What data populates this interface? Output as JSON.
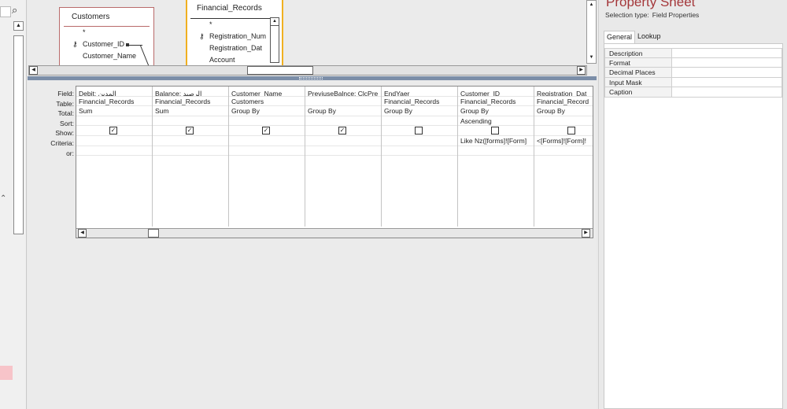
{
  "nav": {
    "search_icon": "search-icon"
  },
  "tables": {
    "customers": {
      "title": "Customers",
      "fields": [
        {
          "name": "*",
          "key": false
        },
        {
          "name": "Customer_ID",
          "key": true
        },
        {
          "name": "Customer_Name",
          "key": false
        }
      ]
    },
    "financial_records": {
      "title": "Financial_Records",
      "fields": [
        {
          "name": "*",
          "key": false
        },
        {
          "name": "Registration_Num",
          "key": true
        },
        {
          "name": "Registration_Dat",
          "key": false
        },
        {
          "name": "Account",
          "key": false
        }
      ]
    }
  },
  "grid": {
    "row_labels": [
      "Field:",
      "Table:",
      "Total:",
      "Sort:",
      "Show:",
      "Criteria:",
      "or:"
    ],
    "columns": [
      {
        "field": "Debit: المدين",
        "table": "Financial_Records",
        "total": "Sum",
        "sort": "",
        "show": true,
        "criteria": "",
        "or": ""
      },
      {
        "field": "Balance: الرصيد",
        "table": "Financial_Records",
        "total": "Sum",
        "sort": "",
        "show": true,
        "criteria": "",
        "or": ""
      },
      {
        "field": "Customer_Name",
        "table": "Customers",
        "total": "Group By",
        "sort": "",
        "show": true,
        "criteria": "",
        "or": ""
      },
      {
        "field": "PreviuseBalnce: ClcPre",
        "table": "",
        "total": "Group By",
        "sort": "",
        "show": true,
        "criteria": "",
        "or": ""
      },
      {
        "field": "EndYaer",
        "table": "Financial_Records",
        "total": "Group By",
        "sort": "",
        "show": false,
        "criteria": "",
        "or": ""
      },
      {
        "field": "Customer_ID",
        "table": "Financial_Records",
        "total": "Group By",
        "sort": "Ascending",
        "show": false,
        "criteria": "Like Nz([forms]![Form]",
        "or": ""
      },
      {
        "field": "Registration_Dat",
        "table": "Financial_Record",
        "total": "Group By",
        "sort": "",
        "show": false,
        "criteria": "<[Forms]![Form]!",
        "or": ""
      }
    ]
  },
  "property_sheet": {
    "title": "Property Sheet",
    "selection_label": "Selection type:",
    "selection_value": "Field Properties",
    "tabs": [
      "General",
      "Lookup"
    ],
    "active_tab": "General",
    "properties": [
      "Description",
      "Format",
      "Decimal Places",
      "Input Mask",
      "Caption"
    ]
  },
  "colors": {
    "title_accent": "#a4373a",
    "active_table_border": "#f0b020",
    "splitter": "#7b8ea8"
  }
}
